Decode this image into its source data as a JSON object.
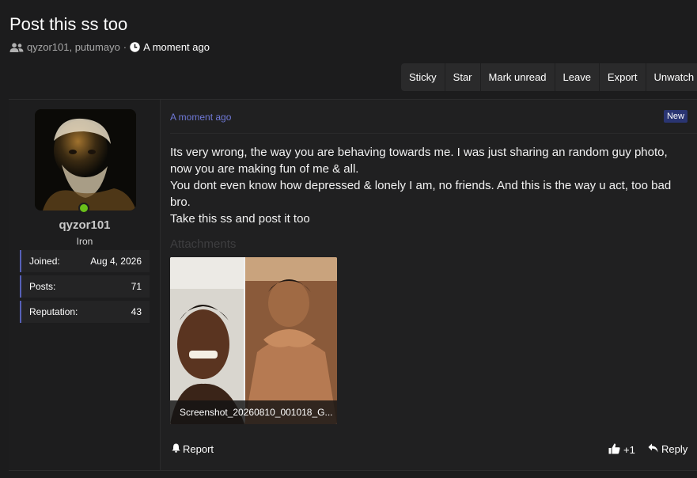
{
  "thread": {
    "title": "Post this ss too",
    "participants": "qyzor101, putumayo",
    "separator": "·",
    "time": "A moment ago"
  },
  "actions": [
    "Sticky",
    "Star",
    "Mark unread",
    "Leave",
    "Export",
    "Unwatch"
  ],
  "author": {
    "username": "qyzor101",
    "rank": "Iron",
    "online": true,
    "stats": [
      {
        "label": "Joined:",
        "value": "Aug 4, 2026"
      },
      {
        "label": "Posts:",
        "value": "71"
      },
      {
        "label": "Reputation:",
        "value": "43"
      }
    ]
  },
  "post": {
    "time": "A moment ago",
    "badge": "New",
    "paragraphs": [
      "Its very wrong, the way you are behaving towards me. I was just sharing an random guy photo, now you are making fun of me & all.",
      "You dont even know how depressed & lonely I am, no friends. And this is the way u act, too bad bro.",
      "Take this ss and post it too"
    ],
    "attachments_label": "Attachments",
    "attachment_name": "Screenshot_20260810_001018_G...",
    "report_label": "Report",
    "like_count": "+1",
    "reply_label": "Reply"
  },
  "icons": {
    "participants": "users-icon",
    "time": "clock-icon",
    "report": "bell-icon",
    "like": "thumbs-up-icon",
    "reply": "reply-arrow-icon"
  },
  "colors": {
    "background": "#1c1c1d",
    "link": "#6f78d6",
    "badge": "#2a3572",
    "stat_accent": "#5660b8",
    "online": "#6abf1a"
  }
}
